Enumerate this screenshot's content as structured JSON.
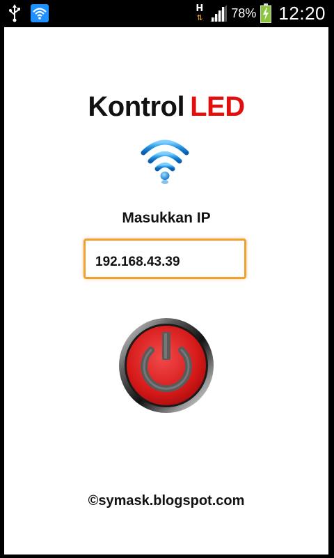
{
  "status_bar": {
    "battery_percent": "78%",
    "time": "12:20",
    "network_type": "H",
    "icons": [
      "usb-icon",
      "wifi-notification-icon",
      "hplus-data-icon",
      "signal-icon",
      "battery-charging-icon"
    ]
  },
  "app": {
    "title_part1": "Kontrol",
    "title_part2": "LED",
    "title_colors": {
      "kontrol": "#111111",
      "led": "#e20e0e"
    },
    "wifi_logo_icon": "wifi-icon",
    "ip_label": "Masukkan IP",
    "ip_value": "192.168.43.39",
    "power_button_icon": "power-icon",
    "footer": "©symask.blogspot.com",
    "accent_color": "#f0a030"
  }
}
